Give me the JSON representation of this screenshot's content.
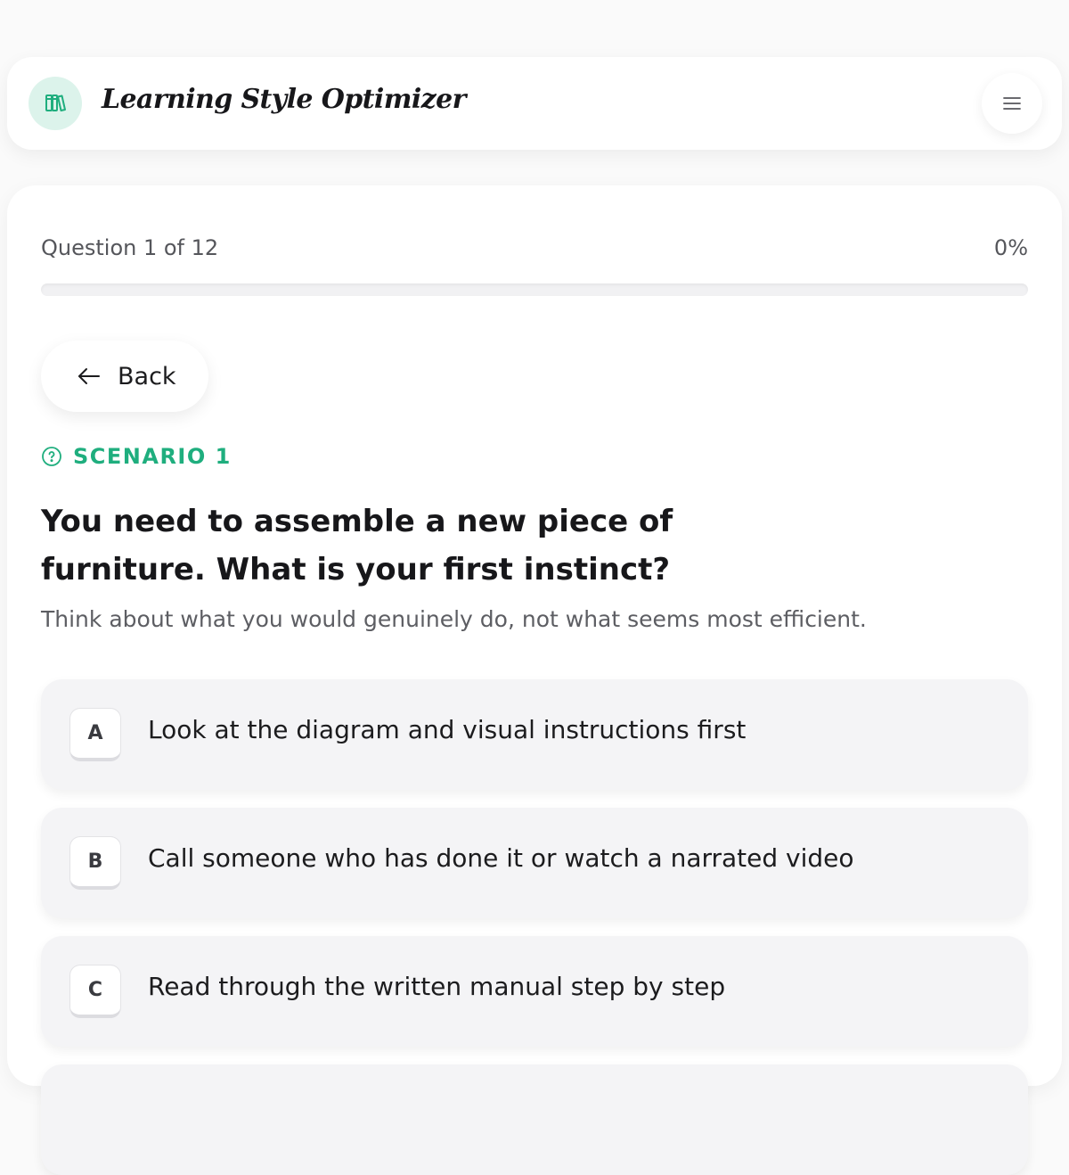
{
  "header": {
    "title": "Learning Style Optimizer",
    "logo_icon": "books-icon",
    "menu_icon": "hamburger-menu-icon"
  },
  "progress": {
    "label": "Question 1 of 12",
    "percent_label": "0%",
    "value": 0
  },
  "navigation": {
    "back_label": "Back",
    "back_icon": "arrow-left-icon"
  },
  "scenario": {
    "label": "SCENARIO 1",
    "icon": "question-circle-icon",
    "question": "You need to assemble a new piece of furniture. What is your first instinct?",
    "hint": "Think about what you would genuinely do, not what seems most efficient."
  },
  "options": [
    {
      "letter": "A",
      "text": "Look at the diagram and visual instructions first"
    },
    {
      "letter": "B",
      "text": "Call someone who has done it or watch a narrated video"
    },
    {
      "letter": "C",
      "text": "Read through the written manual step by step"
    }
  ],
  "colors": {
    "accent": "#1fae7e",
    "accent_soft": "#dcf3eb",
    "option_bg": "#f4f4f6"
  }
}
